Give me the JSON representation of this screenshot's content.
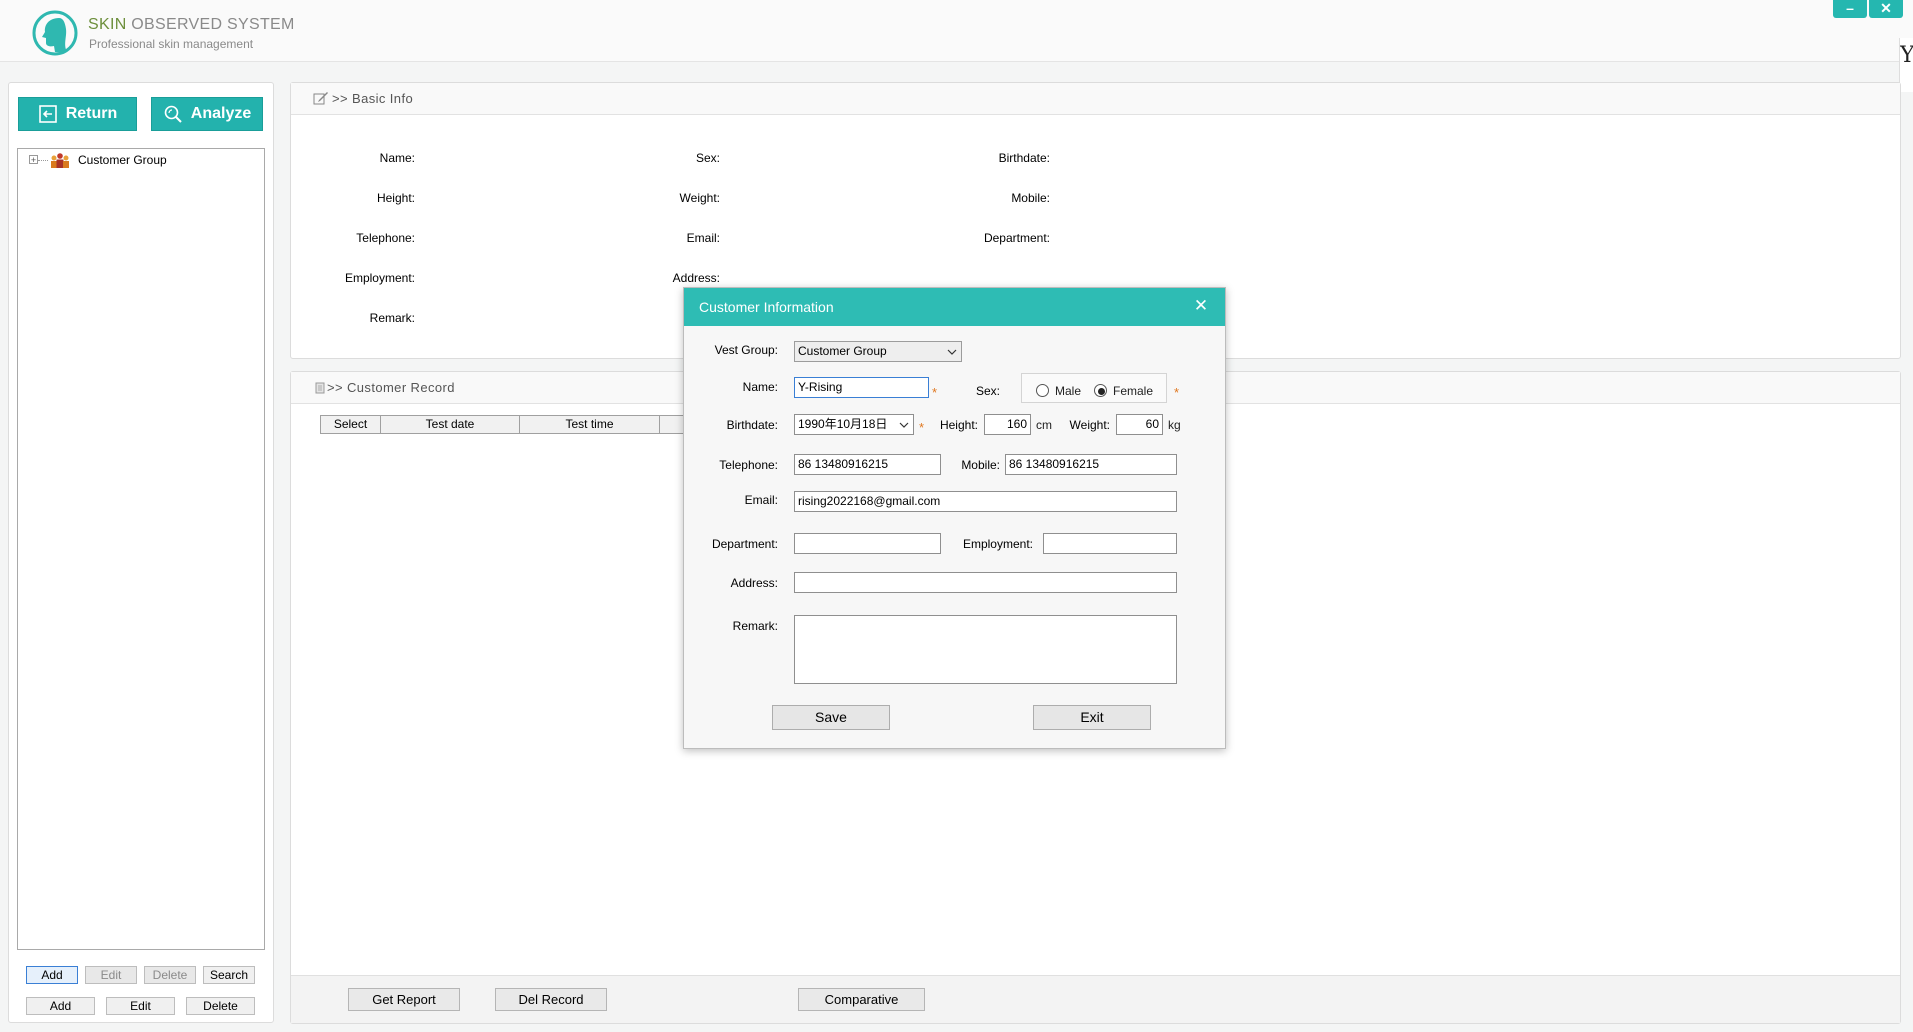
{
  "header": {
    "title_highlight": "SKIN",
    "title_rest": " OBSERVED SYSTEM",
    "subtitle": "Professional skin management",
    "minimize": "–",
    "close": "✕",
    "edge_letter": "Y"
  },
  "left_panel": {
    "return_label": "Return",
    "analyze_label": "Analyze",
    "tree_root": "Customer Group",
    "tree_expander": "+",
    "group_buttons": [
      "Add",
      "Edit",
      "Delete",
      "Search"
    ],
    "customer_buttons": [
      "Add",
      "Edit",
      "Delete"
    ]
  },
  "basic_info": {
    "title": ">> Basic Info",
    "labels": {
      "name": "Name:",
      "sex": "Sex:",
      "birthdate": "Birthdate:",
      "height": "Height:",
      "weight": "Weight:",
      "mobile": "Mobile:",
      "telephone": "Telephone:",
      "email": "Email:",
      "department": "Department:",
      "employment": "Employment:",
      "address": "Address:",
      "remark": "Remark:"
    }
  },
  "customer_record": {
    "title": ">> Customer Record",
    "columns": [
      "Select",
      "Test date",
      "Test time"
    ],
    "buttons": {
      "get_report": "Get Report",
      "del_record": "Del Record",
      "comparative": "Comparative"
    }
  },
  "dialog": {
    "title": "Customer Information",
    "close": "✕",
    "vest_group_label": "Vest Group:",
    "vest_group_value": "Customer Group",
    "name_label": "Name:",
    "name_value": "Y-Rising",
    "sex_label": "Sex:",
    "sex_options": [
      "Male",
      "Female"
    ],
    "sex_selected": "Female",
    "birthdate_label": "Birthdate:",
    "birthdate_value": "1990年10月18日",
    "height_label": "Height:",
    "height_value": "160",
    "height_unit": "cm",
    "weight_label": "Weight:",
    "weight_value": "60",
    "weight_unit": "kg",
    "telephone_label": "Telephone:",
    "telephone_value": "86 13480916215",
    "mobile_label": "Mobile:",
    "mobile_value": "86 13480916215",
    "email_label": "Email:",
    "email_value": "rising2022168@gmail.com",
    "department_label": "Department:",
    "department_value": "",
    "employment_label": "Employment:",
    "employment_value": "",
    "address_label": "Address:",
    "address_value": "",
    "remark_label": "Remark:",
    "remark_value": "",
    "required_mark": "*",
    "save_label": "Save",
    "exit_label": "Exit"
  },
  "colors": {
    "accent": "#2ebcb4",
    "button_teal": "#23b2ad",
    "logo_green": "#6d8f3c",
    "required": "#e07820"
  }
}
